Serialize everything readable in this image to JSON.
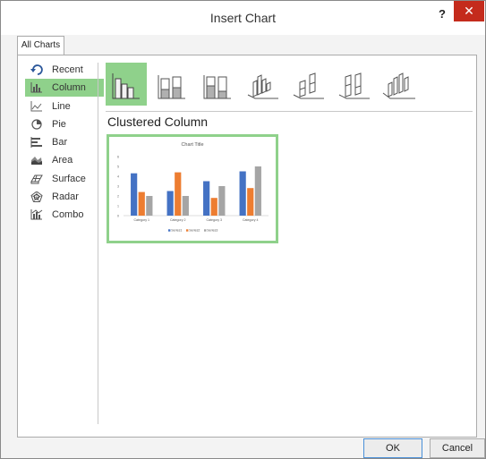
{
  "window": {
    "title": "Insert Chart",
    "help_label": "?",
    "close_label": "✕"
  },
  "tabs": [
    {
      "label": "All Charts"
    }
  ],
  "sidebar": {
    "items": [
      {
        "label": "Recent",
        "icon": "recent-icon"
      },
      {
        "label": "Column",
        "icon": "column-chart-icon",
        "selected": true
      },
      {
        "label": "Line",
        "icon": "line-chart-icon"
      },
      {
        "label": "Pie",
        "icon": "pie-chart-icon"
      },
      {
        "label": "Bar",
        "icon": "bar-chart-icon"
      },
      {
        "label": "Area",
        "icon": "area-chart-icon"
      },
      {
        "label": "Surface",
        "icon": "surface-chart-icon"
      },
      {
        "label": "Radar",
        "icon": "radar-chart-icon"
      },
      {
        "label": "Combo",
        "icon": "combo-chart-icon"
      }
    ]
  },
  "subtypes": [
    {
      "icon": "clustered-column-icon",
      "selected": true
    },
    {
      "icon": "stacked-column-icon"
    },
    {
      "icon": "100-stacked-column-icon"
    },
    {
      "icon": "3d-clustered-column-icon"
    },
    {
      "icon": "3d-stacked-column-icon"
    },
    {
      "icon": "3d-100-stacked-column-icon"
    },
    {
      "icon": "3d-column-icon"
    }
  ],
  "selected_chart_name": "Clustered Column",
  "chart_data": {
    "type": "bar",
    "title": "Chart Title",
    "categories": [
      "Category 1",
      "Category 2",
      "Category 3",
      "Category 4"
    ],
    "series": [
      {
        "name": "Series1",
        "values": [
          4.3,
          2.5,
          3.5,
          4.5
        ],
        "color": "#4472c4"
      },
      {
        "name": "Series2",
        "values": [
          2.4,
          4.4,
          1.8,
          2.8
        ],
        "color": "#ed7d31"
      },
      {
        "name": "Series3",
        "values": [
          2,
          2,
          3,
          5
        ],
        "color": "#a5a5a5"
      }
    ],
    "ylim": [
      0,
      6
    ],
    "yticks": [
      "0",
      "1",
      "2",
      "3",
      "4",
      "5",
      "6"
    ],
    "legend": "bottom",
    "grid": false
  },
  "buttons": {
    "ok": "OK",
    "cancel": "Cancel"
  },
  "colors": {
    "accent": "#8fd18b",
    "close": "#c42b1c"
  }
}
